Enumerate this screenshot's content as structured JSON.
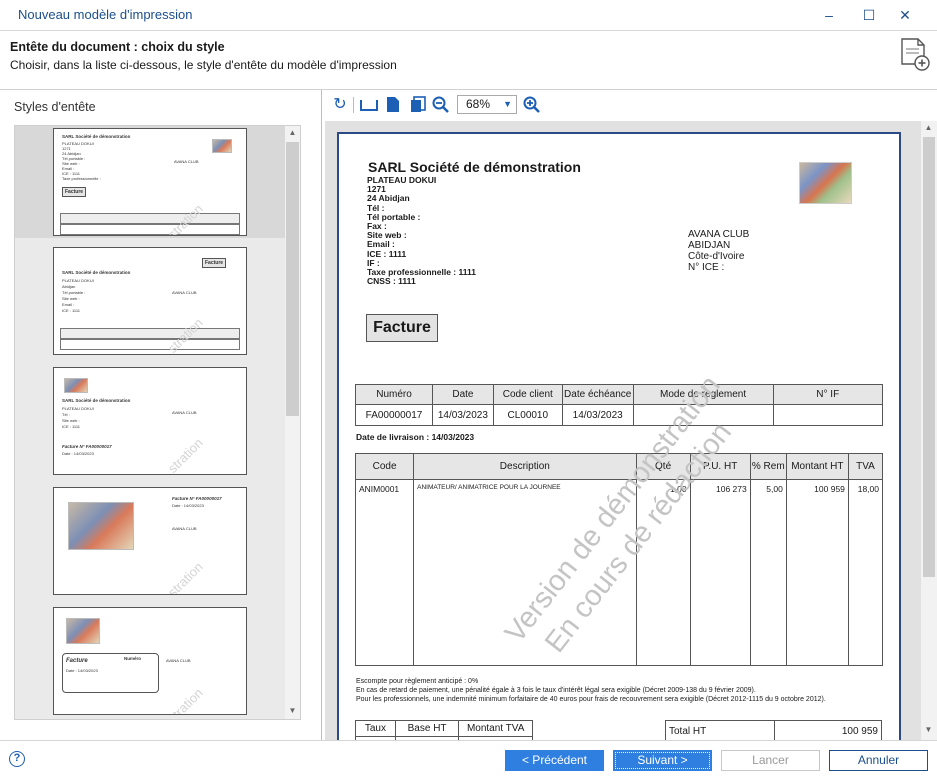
{
  "window": {
    "title": "Nouveau modèle d'impression",
    "minimize": "–",
    "maximize": "☐",
    "close": "✕"
  },
  "header": {
    "title": "Entête du document : choix du style",
    "subtitle": "Choisir, dans la liste ci-dessous, le style d'entête du modèle d'impression"
  },
  "left": {
    "label": "Styles d'entête"
  },
  "thumbs": {
    "company": "SARL Société de démonstration",
    "facture": "Facture",
    "watermark": "stration",
    "client": "AVANA CLUB",
    "factureNo": "Facture N° FA00000017",
    "date": "Date : 14/03/2023",
    "numero": "Numéro"
  },
  "toolbar": {
    "zoom": "68%"
  },
  "preview": {
    "company": "SARL Société de démonstration",
    "address_lines": [
      "PLATEAU DOKUI",
      "1271",
      "24  Abidjan",
      "Tél :",
      "Tél portable :",
      "Fax :",
      "Site web :",
      "Email :",
      "ICE : 1111",
      "IF :",
      "Taxe professionnelle : 1111",
      "CNSS : 1111"
    ],
    "client_lines": [
      "AVANA CLUB",
      " ABIDJAN",
      "Côte-d'Ivoire",
      "N° ICE :"
    ],
    "doc_type": "Facture",
    "meta_headers": [
      "Numéro",
      "Date",
      "Code client",
      "Date échéance",
      "Mode de règlement",
      "N° IF"
    ],
    "meta_values": [
      "FA00000017",
      "14/03/2023",
      "CL00010",
      "14/03/2023",
      "",
      ""
    ],
    "livraison": "Date de livraison : 14/03/2023",
    "line_headers": [
      "Code",
      "Description",
      "Qté",
      "P.U. HT",
      "% Rem",
      "Montant HT",
      "TVA"
    ],
    "line_values": [
      "ANIM0001",
      "ANIMATEUR/ ANIMATRICE POUR LA JOURNEE",
      "1,00",
      "106 273",
      "5,00",
      "100 959",
      "18,00"
    ],
    "watermark1": "Version de démonstration",
    "watermark2": "En cours de rédaction",
    "notes": [
      "Escompte pour règlement anticipé : 0%",
      "En cas de retard de paiement, une pénalité égale à 3 fois le taux d'intérêt légal sera exigible (Décret 2009-138 du 9 février 2009).",
      "Pour les professionnels, une indemnité minimum forfaitaire de 40 euros pour frais de recouvrement sera exigible (Décret 2012-1115 du 9 octobre 2012)."
    ],
    "tax_headers": [
      "Taux",
      "Base HT",
      "Montant TVA"
    ],
    "total_label": "Total HT",
    "total_value": "100 959"
  },
  "footer": {
    "prev": "< Précédent",
    "next": "Suivant >",
    "launch": "Lancer",
    "cancel": "Annuler"
  },
  "colors": {
    "accent": "#2f7fe0",
    "title": "#1c4f8c",
    "page_border": "#2c4a88"
  }
}
